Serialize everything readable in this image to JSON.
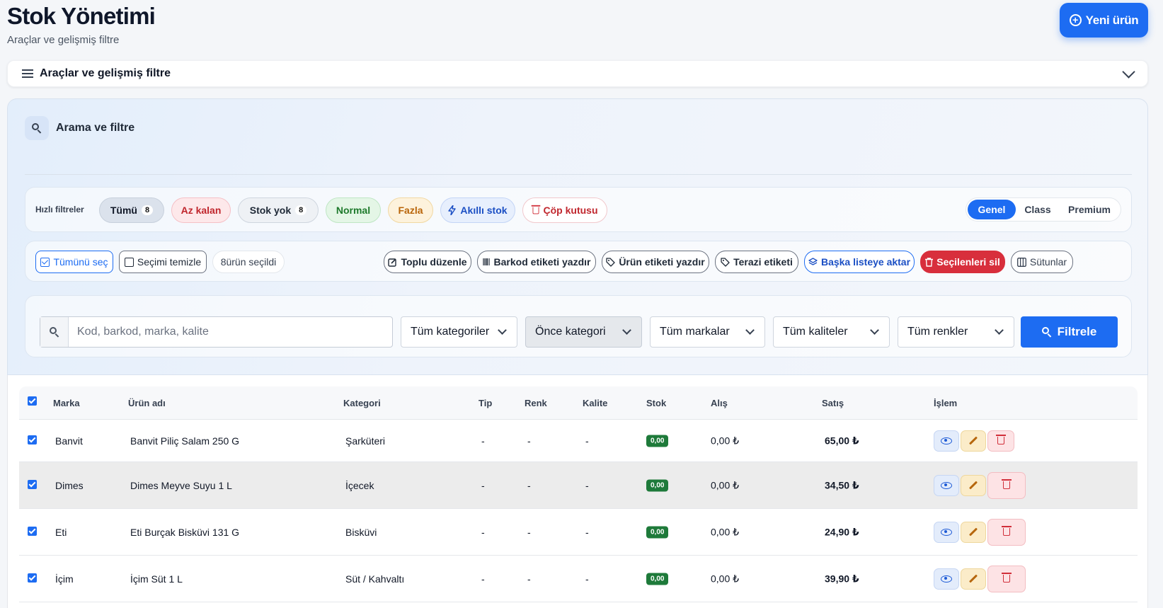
{
  "header": {
    "title": "Stok Yönetimi",
    "subtitle": "Araçlar ve gelişmiş filtre",
    "new_button": "Yeni ürün"
  },
  "tools_bar": {
    "label": "Araçlar ve gelişmiş filtre"
  },
  "search_panel": {
    "title": "Arama ve filtre"
  },
  "quick_filters": {
    "label": "Hızlı filtreler",
    "chips": [
      {
        "label": "Tümü",
        "count": "8"
      },
      {
        "label": "Az kalan"
      },
      {
        "label": "Stok yok",
        "count": "8"
      },
      {
        "label": "Normal"
      },
      {
        "label": "Fazla"
      },
      {
        "label": "Akıllı stok"
      },
      {
        "label": "Çöp kutusu"
      }
    ],
    "tiers": [
      "Genel",
      "Class",
      "Premium"
    ],
    "active_tier": "Genel"
  },
  "bulk_actions": {
    "select_all": "Tümünü seç",
    "clear_selection": "Seçimi temizle",
    "selected_count": "8ürün seçildi",
    "bulk_edit": "Toplu düzenle",
    "print_barcode": "Barkod etiketi yazdır",
    "print_product_label": "Ürün etiketi yazdır",
    "scale_label": "Terazi etiketi",
    "move_list": "Başka listeye aktar",
    "delete_selected": "Seçilenleri sil",
    "columns": "Sütunlar"
  },
  "filters": {
    "search_placeholder": "Kod, barkod, marka, kalite",
    "search_value": "",
    "category": "Tüm kategoriler",
    "subcategory": "Önce kategori",
    "brand": "Tüm markalar",
    "quality": "Tüm kaliteler",
    "color": "Tüm renkler",
    "filter_button": "Filtrele"
  },
  "table": {
    "headers": [
      "Marka",
      "Ürün adı",
      "Kategori",
      "Tip",
      "Renk",
      "Kalite",
      "Stok",
      "Alış",
      "Satış",
      "İşlem"
    ],
    "rows": [
      {
        "brand": "Banvit",
        "name": "Banvit Piliç Salam 250 G",
        "category": "Şarküteri",
        "type": "-",
        "color": "-",
        "quality": "-",
        "stock": "0,00",
        "buy": "0,00 ₺",
        "sell": "65,00 ₺"
      },
      {
        "brand": "Dimes",
        "name": "Dimes Meyve Suyu 1 L",
        "category": "İçecek",
        "type": "-",
        "color": "-",
        "quality": "-",
        "stock": "0,00",
        "buy": "0,00 ₺",
        "sell": "34,50 ₺"
      },
      {
        "brand": "Eti",
        "name": "Eti Burçak Bisküvi 131 G",
        "category": "Bisküvi",
        "type": "-",
        "color": "-",
        "quality": "-",
        "stock": "0,00",
        "buy": "0,00 ₺",
        "sell": "24,90 ₺"
      },
      {
        "brand": "İçim",
        "name": "İçim Süt 1 L",
        "category": "Süt / Kahvaltı",
        "type": "-",
        "color": "-",
        "quality": "-",
        "stock": "0,00",
        "buy": "0,00 ₺",
        "sell": "39,90 ₺"
      }
    ]
  }
}
